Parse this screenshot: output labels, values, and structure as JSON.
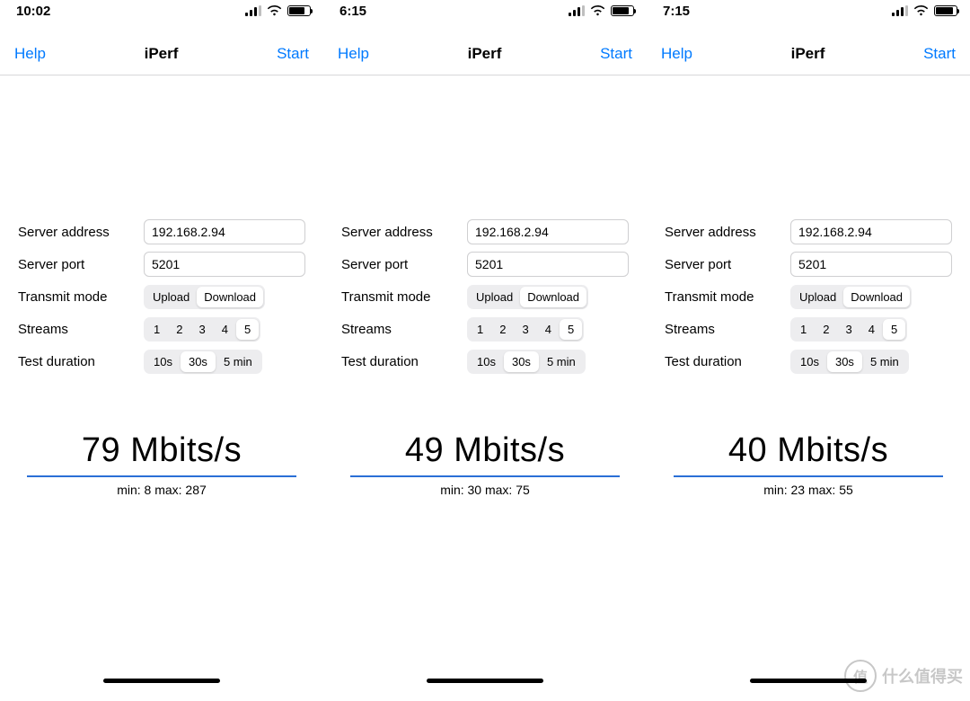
{
  "watermark_text": "什么值得买",
  "watermark_badge": "值",
  "panels": [
    {
      "status": {
        "time": "10:02",
        "signal_bars": 3,
        "battery_pct": 78
      },
      "nav": {
        "help": "Help",
        "title": "iPerf",
        "start": "Start"
      },
      "form": {
        "server_address_label": "Server address",
        "server_address_value": "192.168.2.94",
        "server_port_label": "Server port",
        "server_port_value": "5201",
        "transmit_mode_label": "Transmit mode",
        "mode_options": [
          "Upload",
          "Download"
        ],
        "mode_selected": "Download",
        "streams_label": "Streams",
        "streams_options": [
          "1",
          "2",
          "3",
          "4",
          "5"
        ],
        "streams_selected": "5",
        "duration_label": "Test duration",
        "duration_options": [
          "10s",
          "30s",
          "5 min"
        ],
        "duration_selected": "30s"
      },
      "result": {
        "speed": "79 Mbits/s",
        "minmax": "min: 8 max: 287"
      }
    },
    {
      "status": {
        "time": "6:15",
        "signal_bars": 3,
        "battery_pct": 82
      },
      "nav": {
        "help": "Help",
        "title": "iPerf",
        "start": "Start"
      },
      "form": {
        "server_address_label": "Server address",
        "server_address_value": "192.168.2.94",
        "server_port_label": "Server port",
        "server_port_value": "5201",
        "transmit_mode_label": "Transmit mode",
        "mode_options": [
          "Upload",
          "Download"
        ],
        "mode_selected": "Download",
        "streams_label": "Streams",
        "streams_options": [
          "1",
          "2",
          "3",
          "4",
          "5"
        ],
        "streams_selected": "5",
        "duration_label": "Test duration",
        "duration_options": [
          "10s",
          "30s",
          "5 min"
        ],
        "duration_selected": "30s"
      },
      "result": {
        "speed": "49 Mbits/s",
        "minmax": "min: 30 max: 75"
      }
    },
    {
      "status": {
        "time": "7:15",
        "signal_bars": 3,
        "battery_pct": 88
      },
      "nav": {
        "help": "Help",
        "title": "iPerf",
        "start": "Start"
      },
      "form": {
        "server_address_label": "Server address",
        "server_address_value": "192.168.2.94",
        "server_port_label": "Server port",
        "server_port_value": "5201",
        "transmit_mode_label": "Transmit mode",
        "mode_options": [
          "Upload",
          "Download"
        ],
        "mode_selected": "Download",
        "streams_label": "Streams",
        "streams_options": [
          "1",
          "2",
          "3",
          "4",
          "5"
        ],
        "streams_selected": "5",
        "duration_label": "Test duration",
        "duration_options": [
          "10s",
          "30s",
          "5 min"
        ],
        "duration_selected": "30s"
      },
      "result": {
        "speed": "40 Mbits/s",
        "minmax": "min: 23 max: 55"
      }
    }
  ]
}
